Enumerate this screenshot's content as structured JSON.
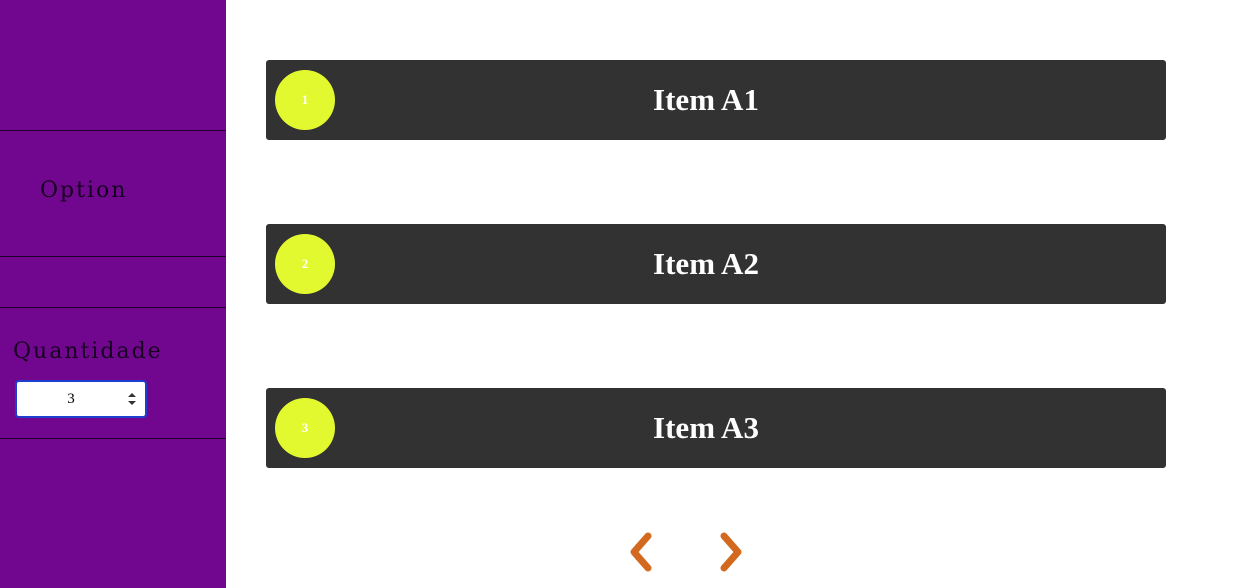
{
  "sidebar": {
    "option_label": "Option",
    "quantity_label": "Quantidade",
    "quantity_value": "3"
  },
  "items": [
    {
      "badge": "1",
      "title": "Item A1"
    },
    {
      "badge": "2",
      "title": "Item A2"
    },
    {
      "badge": "3",
      "title": "Item A3"
    }
  ],
  "pagination": {
    "prev_icon": "chevron-left-icon",
    "next_icon": "chevron-right-icon"
  },
  "colors": {
    "sidebar_bg": "#72078f",
    "card_bg": "#323232",
    "badge_bg": "#e3f92f",
    "arrow": "#d2691e",
    "input_border": "#1d3fd0"
  }
}
